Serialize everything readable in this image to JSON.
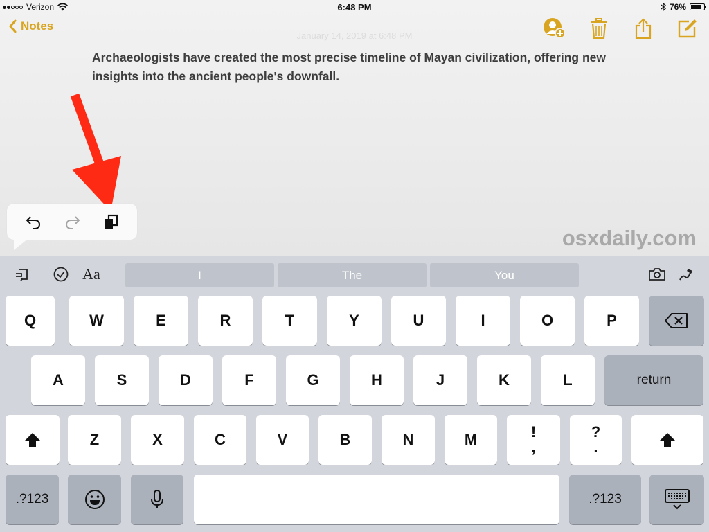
{
  "status_bar": {
    "carrier": "Verizon",
    "time": "6:48 PM",
    "battery_percent": "76%",
    "battery_level": 0.76,
    "signal_bars_filled": 2,
    "signal_bars_total": 5
  },
  "nav": {
    "back_label": "Notes",
    "actions": [
      "add-people-icon",
      "trash-icon",
      "share-icon",
      "compose-icon"
    ],
    "accent_color": "#d9a520"
  },
  "note": {
    "ghost_date": "January 14, 2019 at 6:48 PM",
    "body": "Archaeologists have created the most precise timeline of Mayan civilization, offering new insights into the ancient people's downfall."
  },
  "edit_popover": {
    "buttons": [
      "undo-icon",
      "redo-icon",
      "copy-icon"
    ]
  },
  "watermark": "osxdaily.com",
  "keyboard": {
    "shortcuts_left": [
      "format-icon",
      "checklist-icon",
      "text-style-icon"
    ],
    "text_style_label": "Aa",
    "predictions": [
      "I",
      "The",
      "You"
    ],
    "shortcuts_right": [
      "camera-icon",
      "sketch-icon"
    ],
    "row1": [
      "Q",
      "W",
      "E",
      "R",
      "T",
      "Y",
      "U",
      "I",
      "O",
      "P"
    ],
    "row2": [
      "A",
      "S",
      "D",
      "F",
      "G",
      "H",
      "J",
      "K",
      "L"
    ],
    "row3": [
      "Z",
      "X",
      "C",
      "V",
      "B",
      "N",
      "M"
    ],
    "row3_punct": [
      {
        "top": "!",
        "bottom": ","
      },
      {
        "top": "?",
        "bottom": "."
      }
    ],
    "return_label": "return",
    "numbers_label": ".?123",
    "numbers_label_right": ".?123"
  }
}
